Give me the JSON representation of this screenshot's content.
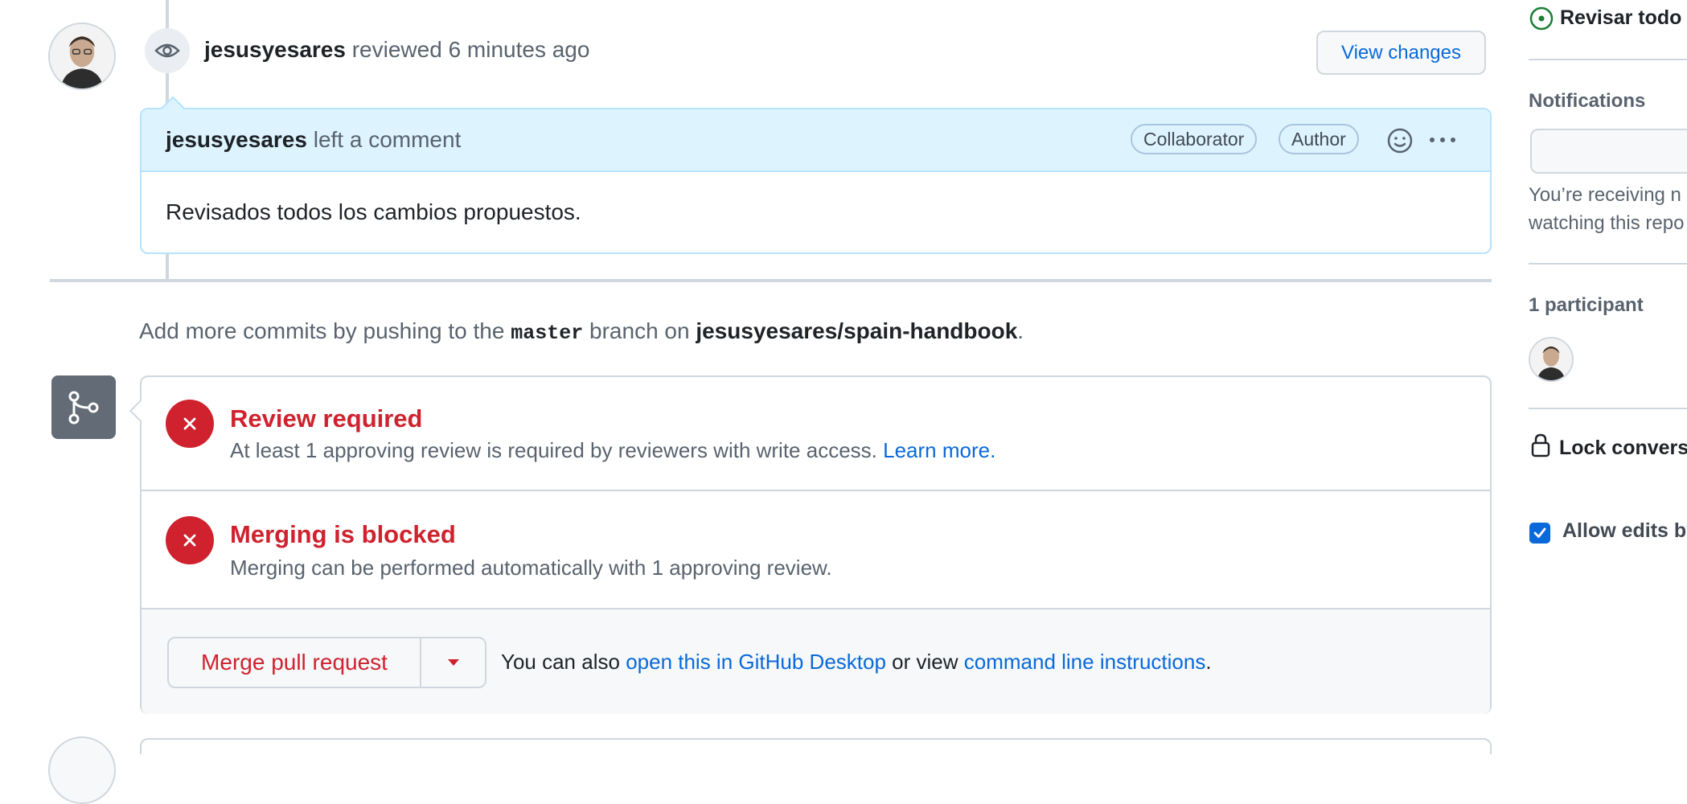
{
  "review_event": {
    "author": "jesusyesares",
    "action": "reviewed",
    "time": "6 minutes ago",
    "view_changes_label": "View changes"
  },
  "comment": {
    "author": "jesusyesares",
    "action": "left a comment",
    "badges": [
      "Collaborator",
      "Author"
    ],
    "body": "Revisados todos los cambios propuestos."
  },
  "push_note": {
    "prefix": "Add more commits by pushing to the",
    "branch": "master",
    "middle": "branch on",
    "repo": "jesusyesares/spain-handbook",
    "suffix": "."
  },
  "merge_status": {
    "checks": [
      {
        "title": "Review required",
        "description": "At least 1 approving review is required by reviewers with write access.",
        "link": "Learn more."
      },
      {
        "title": "Merging is blocked",
        "description": "Merging can be performed automatically with 1 approving review."
      }
    ],
    "merge_button_label": "Merge pull request",
    "footer": {
      "prefix": "You can also",
      "desktop_link": "open this in GitHub Desktop",
      "middle": "or view",
      "cli_link": "command line instructions",
      "suffix": "."
    }
  },
  "sidebar": {
    "top_item": "Revisar todo",
    "notifications_heading": "Notifications",
    "notifications_text_line1": "You’re receiving n",
    "notifications_text_line2": "watching this repo",
    "participants_heading": "1 participant",
    "lock_label": "Lock conversa",
    "allow_edits_label": "Allow edits by",
    "allow_edits_checked": true
  },
  "colors": {
    "danger": "#cf222e",
    "link": "#0969da",
    "comment_header_bg": "#ddf4ff",
    "success": "#1a7f37"
  }
}
